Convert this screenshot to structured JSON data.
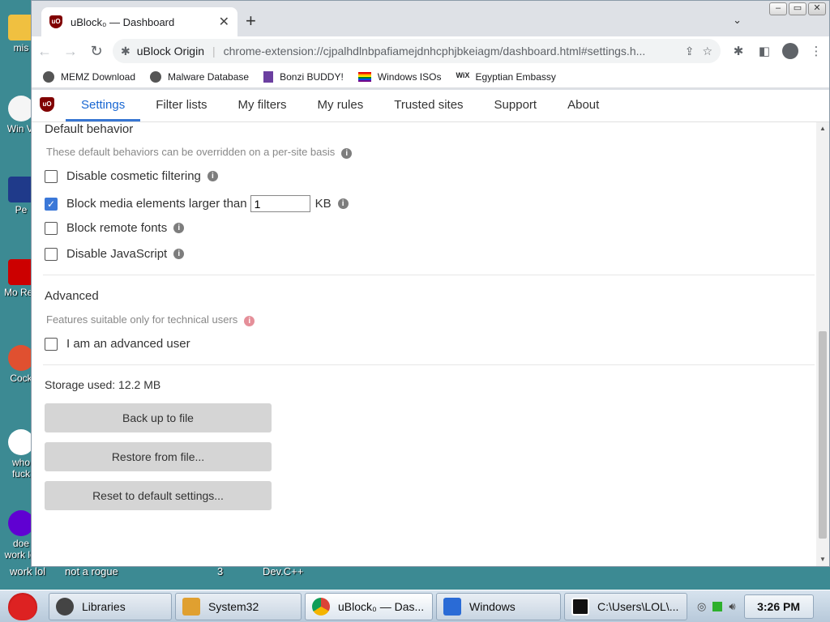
{
  "desktop": {
    "icons": [
      {
        "label": "mis",
        "icon": "folder-icon"
      },
      {
        "label": "Win Vi",
        "icon": "player-icon"
      },
      {
        "label": "Pe",
        "icon": "photoshop-icon"
      },
      {
        "label": "Mo Rea",
        "icon": "pdf-icon"
      },
      {
        "label": "Cock",
        "icon": "cocktail-icon"
      },
      {
        "label": "who fuck",
        "icon": "vlc-icon"
      },
      {
        "label": "doe work lol",
        "icon": "yahoo-icon"
      }
    ],
    "bottom_labels": [
      "work lol",
      "not a rogue",
      "3",
      "Dev.C++"
    ]
  },
  "browser": {
    "tab_title": "uBlock₀ — Dashboard",
    "site_chip": "uBlock Origin",
    "url": "chrome-extension://cjpalhdlnbpafiamejdnhcphjbkeiagm/dashboard.html#settings.h...",
    "bookmarks": [
      {
        "label": "MEMZ Download",
        "icon": "globe-icon"
      },
      {
        "label": "Malware Database",
        "icon": "globe-icon"
      },
      {
        "label": "Bonzi BUDDY!",
        "icon": "bonzi-icon"
      },
      {
        "label": "Windows ISOs",
        "icon": "rainbow-flag-icon"
      },
      {
        "label": "Egyptian Embassy",
        "icon": "wix-icon"
      }
    ]
  },
  "ublock": {
    "tabs": [
      "Settings",
      "Filter lists",
      "My filters",
      "My rules",
      "Trusted sites",
      "Support",
      "About"
    ],
    "active_tab": "Settings",
    "default_behavior": {
      "title": "Default behavior",
      "desc": "These default behaviors can be overridden on a per-site basis",
      "options": [
        {
          "label": "Disable cosmetic filtering",
          "checked": false
        },
        {
          "label": "Block media elements larger than",
          "checked": true,
          "value": "1",
          "unit": "KB"
        },
        {
          "label": "Block remote fonts",
          "checked": false
        },
        {
          "label": "Disable JavaScript",
          "checked": false
        }
      ]
    },
    "advanced": {
      "title": "Advanced",
      "desc": "Features suitable only for technical users",
      "option": {
        "label": "I am an advanced user",
        "checked": false
      }
    },
    "storage_used": "Storage used: 12.2 MB",
    "buttons": {
      "backup": "Back up to file",
      "restore": "Restore from file...",
      "reset": "Reset to default settings..."
    }
  },
  "taskbar": {
    "tasks": [
      "Libraries",
      "System32",
      "uBlock₀ — Das...",
      "Windows",
      "C:\\Users\\LOL\\..."
    ],
    "active_task": "uBlock₀ — Das...",
    "clock": "3:26 PM"
  }
}
